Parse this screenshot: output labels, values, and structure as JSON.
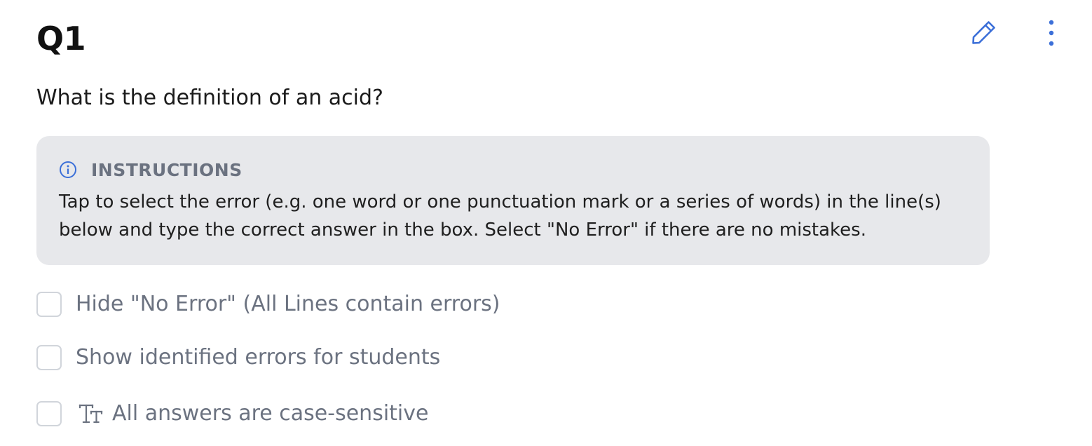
{
  "question": {
    "number_label": "Q1",
    "text": "What is the definition of an acid?"
  },
  "toolbar": {
    "edit_icon": "pencil-icon",
    "more_icon": "vertical-ellipsis-icon"
  },
  "instructions": {
    "icon": "info-icon",
    "title": "INSTRUCTIONS",
    "body": "Tap to select the error (e.g. one word or one punctuation mark or a series of words) in the line(s) below and type the correct answer in the box. Select \"No Error\" if there are no mistakes."
  },
  "options": [
    {
      "label": "Hide \"No Error\" (All Lines contain errors)",
      "checked": false
    },
    {
      "label": "Show identified errors for students",
      "checked": false
    },
    {
      "label": "All answers are case-sensitive",
      "checked": false,
      "icon": "text-size-icon"
    }
  ],
  "colors": {
    "accent": "#3b6fd8",
    "muted_text": "#6b7280",
    "panel_bg": "#e7e8eb",
    "checkbox_border": "#d1d5db"
  }
}
